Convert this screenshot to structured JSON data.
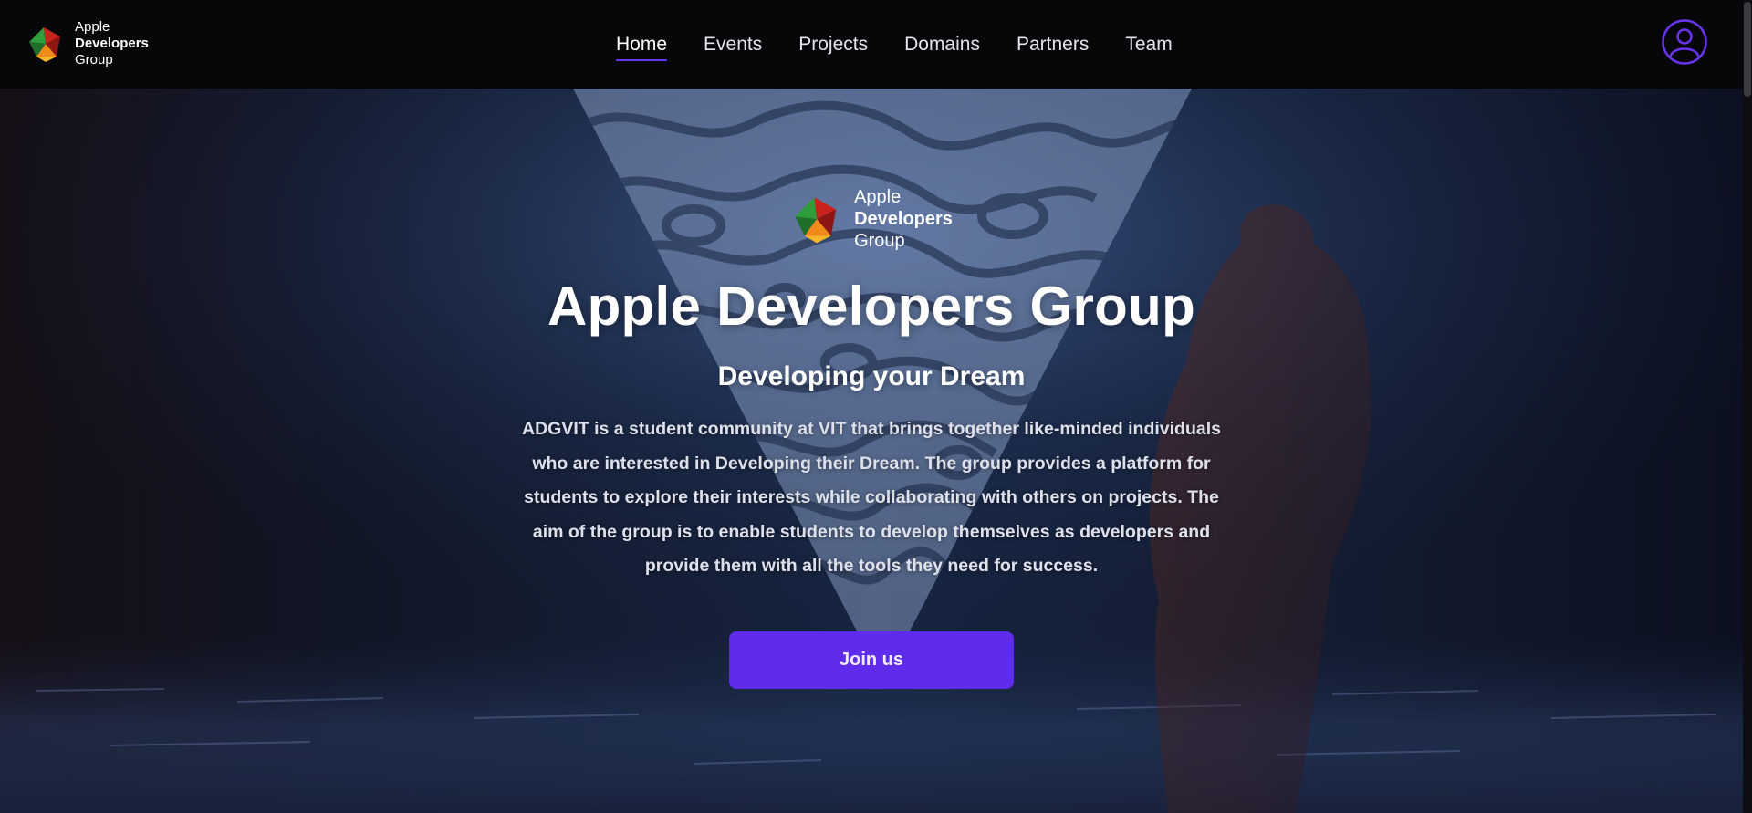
{
  "brand": {
    "line1": "Apple",
    "line2": "Developers",
    "line3": "Group",
    "logo_icon": "adg-logo-icon"
  },
  "nav": {
    "items": [
      {
        "label": "Home",
        "active": true
      },
      {
        "label": "Events",
        "active": false
      },
      {
        "label": "Projects",
        "active": false
      },
      {
        "label": "Domains",
        "active": false
      },
      {
        "label": "Partners",
        "active": false
      },
      {
        "label": "Team",
        "active": false
      }
    ],
    "profile_icon": "user-circle-icon"
  },
  "hero": {
    "logo": {
      "line1": "Apple",
      "line2": "Developers",
      "line3": "Group"
    },
    "title": "Apple Developers Group",
    "subtitle": "Developing your Dream",
    "description": "ADGVIT is a student community at VIT that brings together like-minded individuals who are interested in Developing their Dream. The group provides a platform for students to explore their interests while collaborating with others on projects. The aim of the group is to enable students to develop themselves as developers and provide them with all the tools they need for success.",
    "cta_label": "Join us"
  },
  "colors": {
    "accent": "#5f2ced",
    "nav_underline": "#6a35f0",
    "navbar_bg": "#070709",
    "hero_bg": "#0b0e1a"
  }
}
